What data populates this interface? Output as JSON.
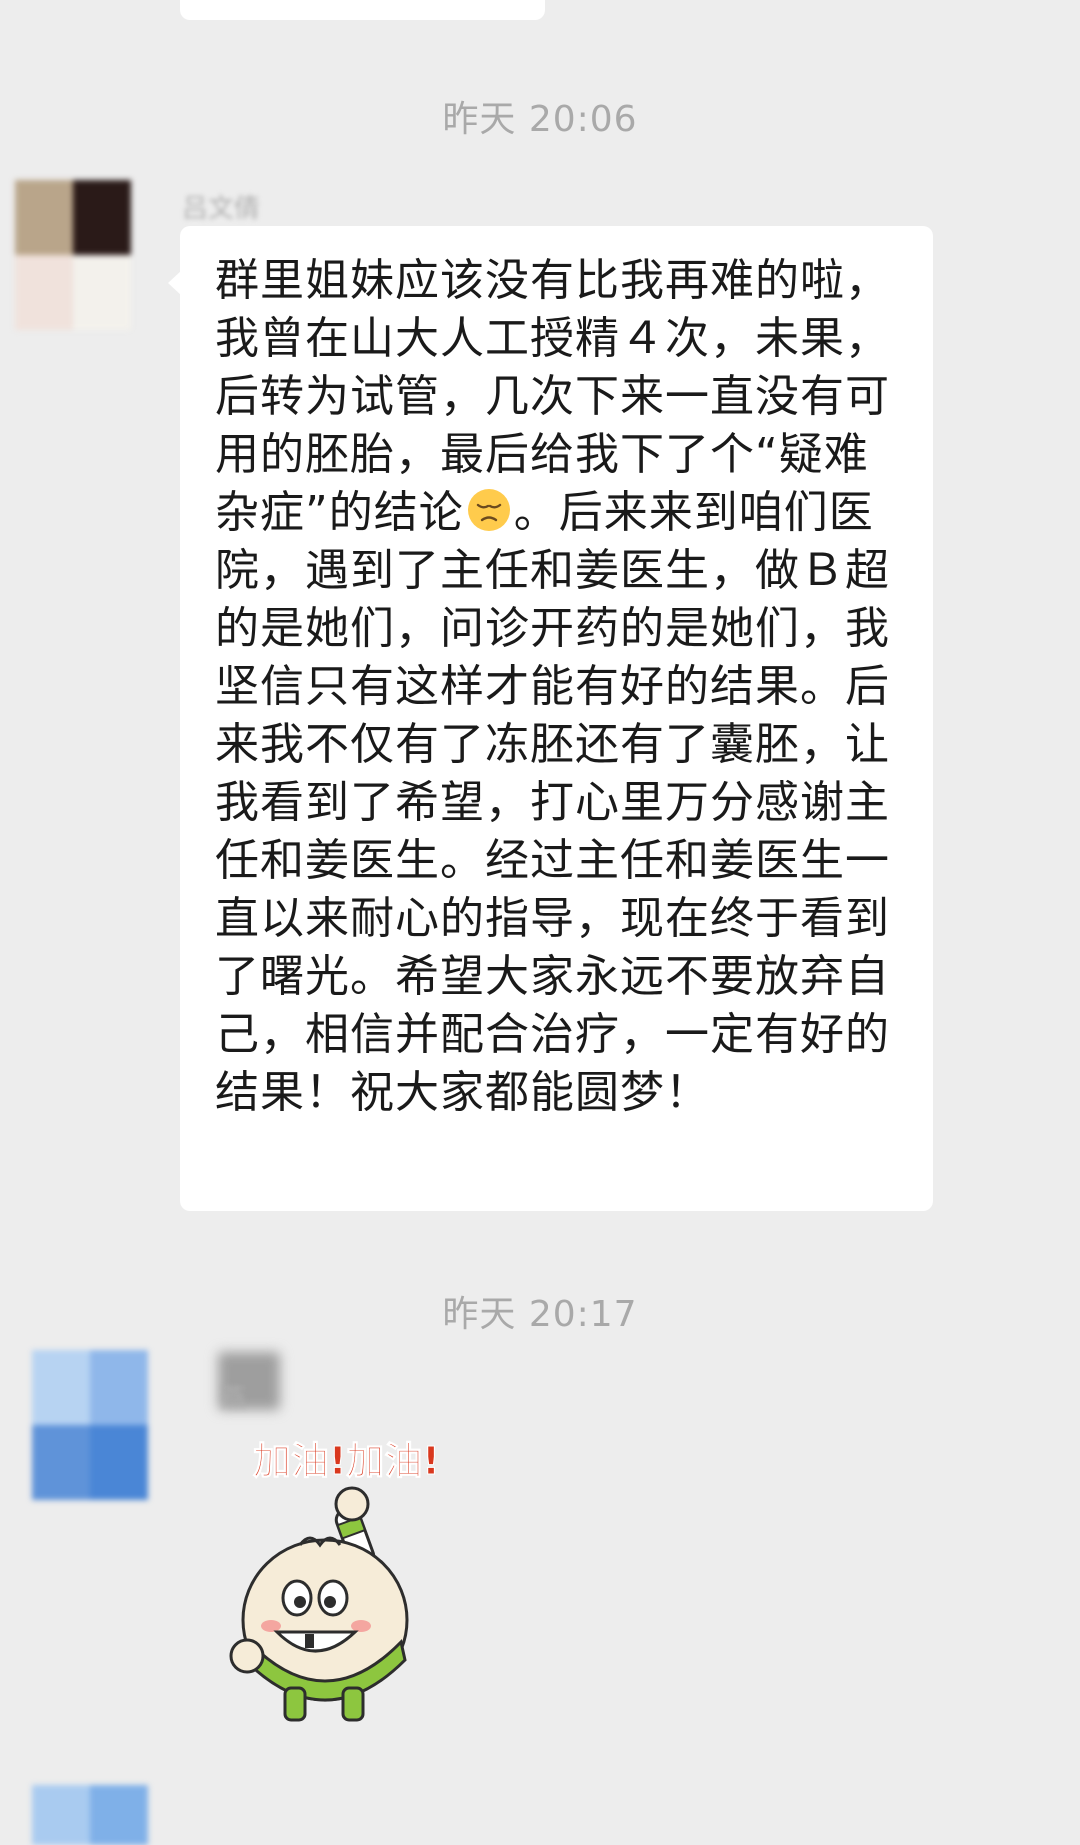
{
  "chat": {
    "timestamp_1": "昨天 20:06",
    "timestamp_2": "昨天 20:17"
  },
  "message_1": {
    "sender": "吕文倩",
    "text_before_emoji": "群里姐妹应该没有比我再难的啦，我曾在山大人工授精４次，未果，后转为试管，几次下来一直没有可用的胚胎，最后给我下了个“疑难杂症”的结论",
    "emoji": "pensive-face",
    "text_after_emoji": "。后来来到咱们医院，遇到了主任和姜医生，做Ｂ超的是她们，问诊开药的是她们，我坚信只有这样才能有好的结果。后来我不仅有了冻胚还有了囊胚，让我看到了希望，打心里万分感谢主任和姜医生。经过主任和姜医生一直以来耐心的指导，现在终于看到了曙光。希望大家永远不要放弃自己，相信并配合治疗，一定有好的结果！祝大家都能圆梦！"
  },
  "message_2": {
    "sender": "燕",
    "sticker_text": "加油!加油!",
    "sticker": "cheering-bun-sticker"
  },
  "colors": {
    "background": "#ededed",
    "bubble": "#ffffff",
    "timestamp": "#a9a9a9",
    "text": "#1a1a1a"
  }
}
